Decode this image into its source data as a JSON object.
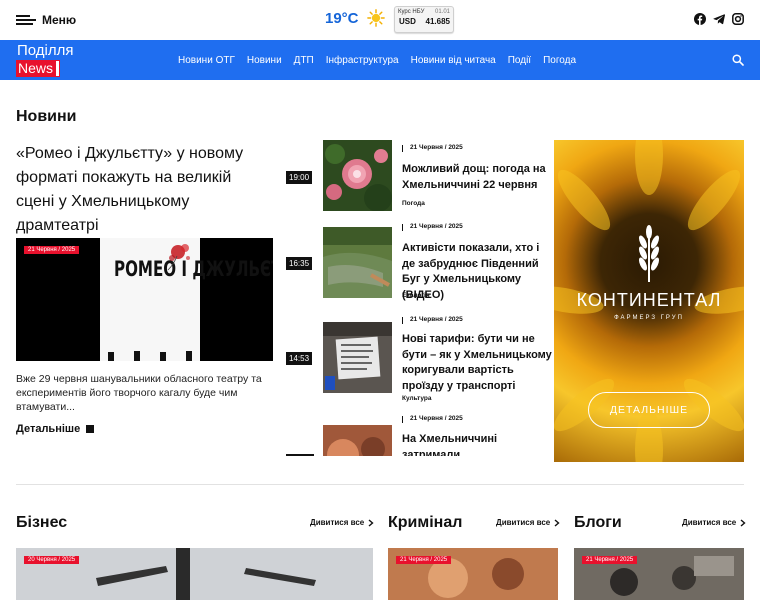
{
  "header": {
    "menu_label": "Меню",
    "temperature": "19°C",
    "weather_icon": "sun-icon",
    "rate": {
      "title": "Курс НБУ",
      "date": "01.01",
      "currency": "USD",
      "value": "41.685"
    },
    "socials": [
      "facebook-icon",
      "telegram-icon",
      "instagram-icon"
    ]
  },
  "nav": {
    "logo_top": "Поділля",
    "logo_bottom": "News",
    "items": [
      "Новини ОТГ",
      "Новини",
      "ДТП",
      "Інфраструктура",
      "Новини від читача",
      "Події",
      "Погода"
    ]
  },
  "news": {
    "section_title": "Новини",
    "main": {
      "title": "«Ромео і Джульєтту» у новому форматі покажуть на великій сцені у Хмельницькому драмтеатрі",
      "date": "21 Червня / 2025",
      "poster_text": "РОМЕО І ДЖУЛЬЄТТА",
      "lead": "Вже 29 червня шанувальники обласного театру та експериментів його творчого кагалу буде чим втамувати...",
      "more_label": "Детальніше"
    },
    "list": [
      {
        "time": "19:00",
        "date": "21 Червня / 2025",
        "title": "Можливий дощ: погода на Хмельниччині 22 червня",
        "category": "Погода"
      },
      {
        "time": "16:35",
        "date": "21 Червня / 2025",
        "title": "Активісти показали, хто і де забруднює Південний Буг у Хмельницькому (ВІДЕО)",
        "category": "Екологія"
      },
      {
        "time": "14:53",
        "date": "21 Червня / 2025",
        "title": "Нові тарифи: бути чи не бути – як у Хмельницькому коригували вартість проїзду у транспорті",
        "category": "Культура"
      },
      {
        "time": "",
        "date": "21 Червня / 2025",
        "title": "На Хмельниччині затримали військовослужбовця, який",
        "category": ""
      }
    ]
  },
  "ad": {
    "brand": "КОНТИНЕНТАЛ",
    "sub": "ФАРМЕРЗ ГРУП",
    "button": "ДЕТАЛЬНІШЕ"
  },
  "sections": [
    {
      "title": "Бізнес",
      "see_all": "Дивитися все",
      "date": "20 Червня / 2025"
    },
    {
      "title": "Кримінал",
      "see_all": "Дивитися все",
      "date": "21 Червня / 2025"
    },
    {
      "title": "Блоги",
      "see_all": "Дивитися все",
      "date": "21 Червня / 2025"
    }
  ],
  "colors": {
    "brand_blue": "#1f6ef0",
    "accent_red": "#e8112d",
    "temp_blue": "#1565d8"
  }
}
